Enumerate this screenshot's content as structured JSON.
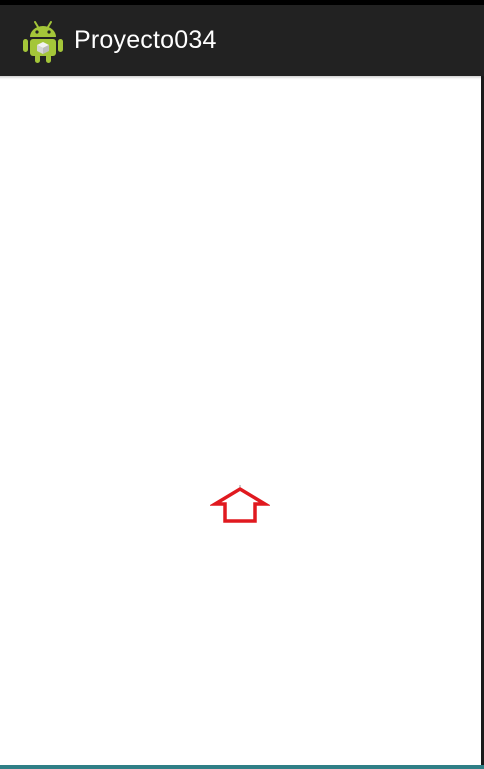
{
  "app": {
    "title": "Proyecto034",
    "icon": "android-robot-icon"
  },
  "content": {
    "arrow_icon": "arrow-up-outline-icon",
    "arrow_color": "#e0191f"
  },
  "colors": {
    "action_bar": "#222222",
    "background": "#ffffff",
    "bottom_accent": "#2f7f86"
  }
}
